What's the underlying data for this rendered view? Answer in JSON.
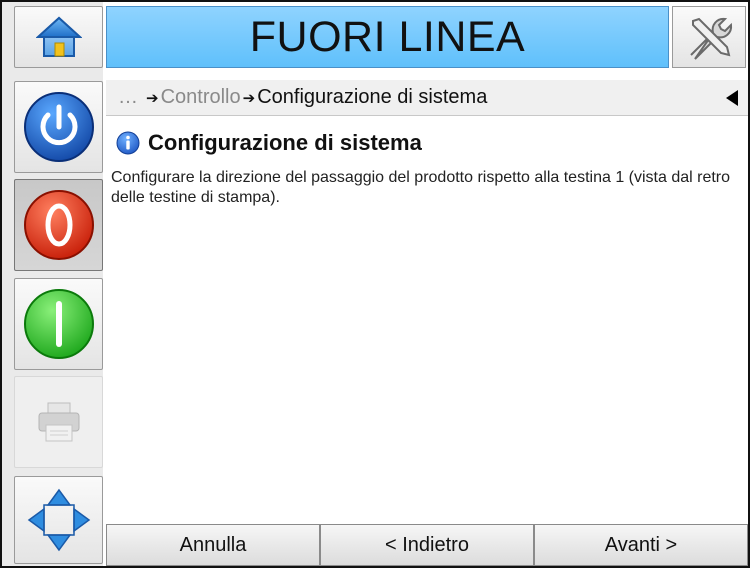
{
  "header": {
    "title": "FUORI LINEA",
    "home_icon": "home-icon",
    "tools_icon": "tools-icon"
  },
  "sidebar": {
    "items": [
      {
        "icon": "power-icon",
        "state": "normal"
      },
      {
        "icon": "stop-icon",
        "state": "pressed"
      },
      {
        "icon": "start-icon",
        "state": "normal"
      },
      {
        "icon": "printer-icon",
        "state": "disabled"
      },
      {
        "icon": "navigation-arrows-icon",
        "state": "normal"
      }
    ]
  },
  "breadcrumb": {
    "ellipsis": "…",
    "parent": "Controllo",
    "current": "Configurazione di sistema",
    "separator": "➔"
  },
  "content": {
    "title": "Configurazione di sistema",
    "body": "Configurare la direzione del passaggio del prodotto rispetto alla testina 1 (vista dal retro delle testine di stampa)."
  },
  "buttons": {
    "cancel": "Annulla",
    "back": "< Indietro",
    "next": "Avanti >"
  },
  "colors": {
    "title_bar": "#6cc6fb",
    "power": "#1a5fc8",
    "stop": "#e2341a",
    "start": "#2bc42b"
  }
}
